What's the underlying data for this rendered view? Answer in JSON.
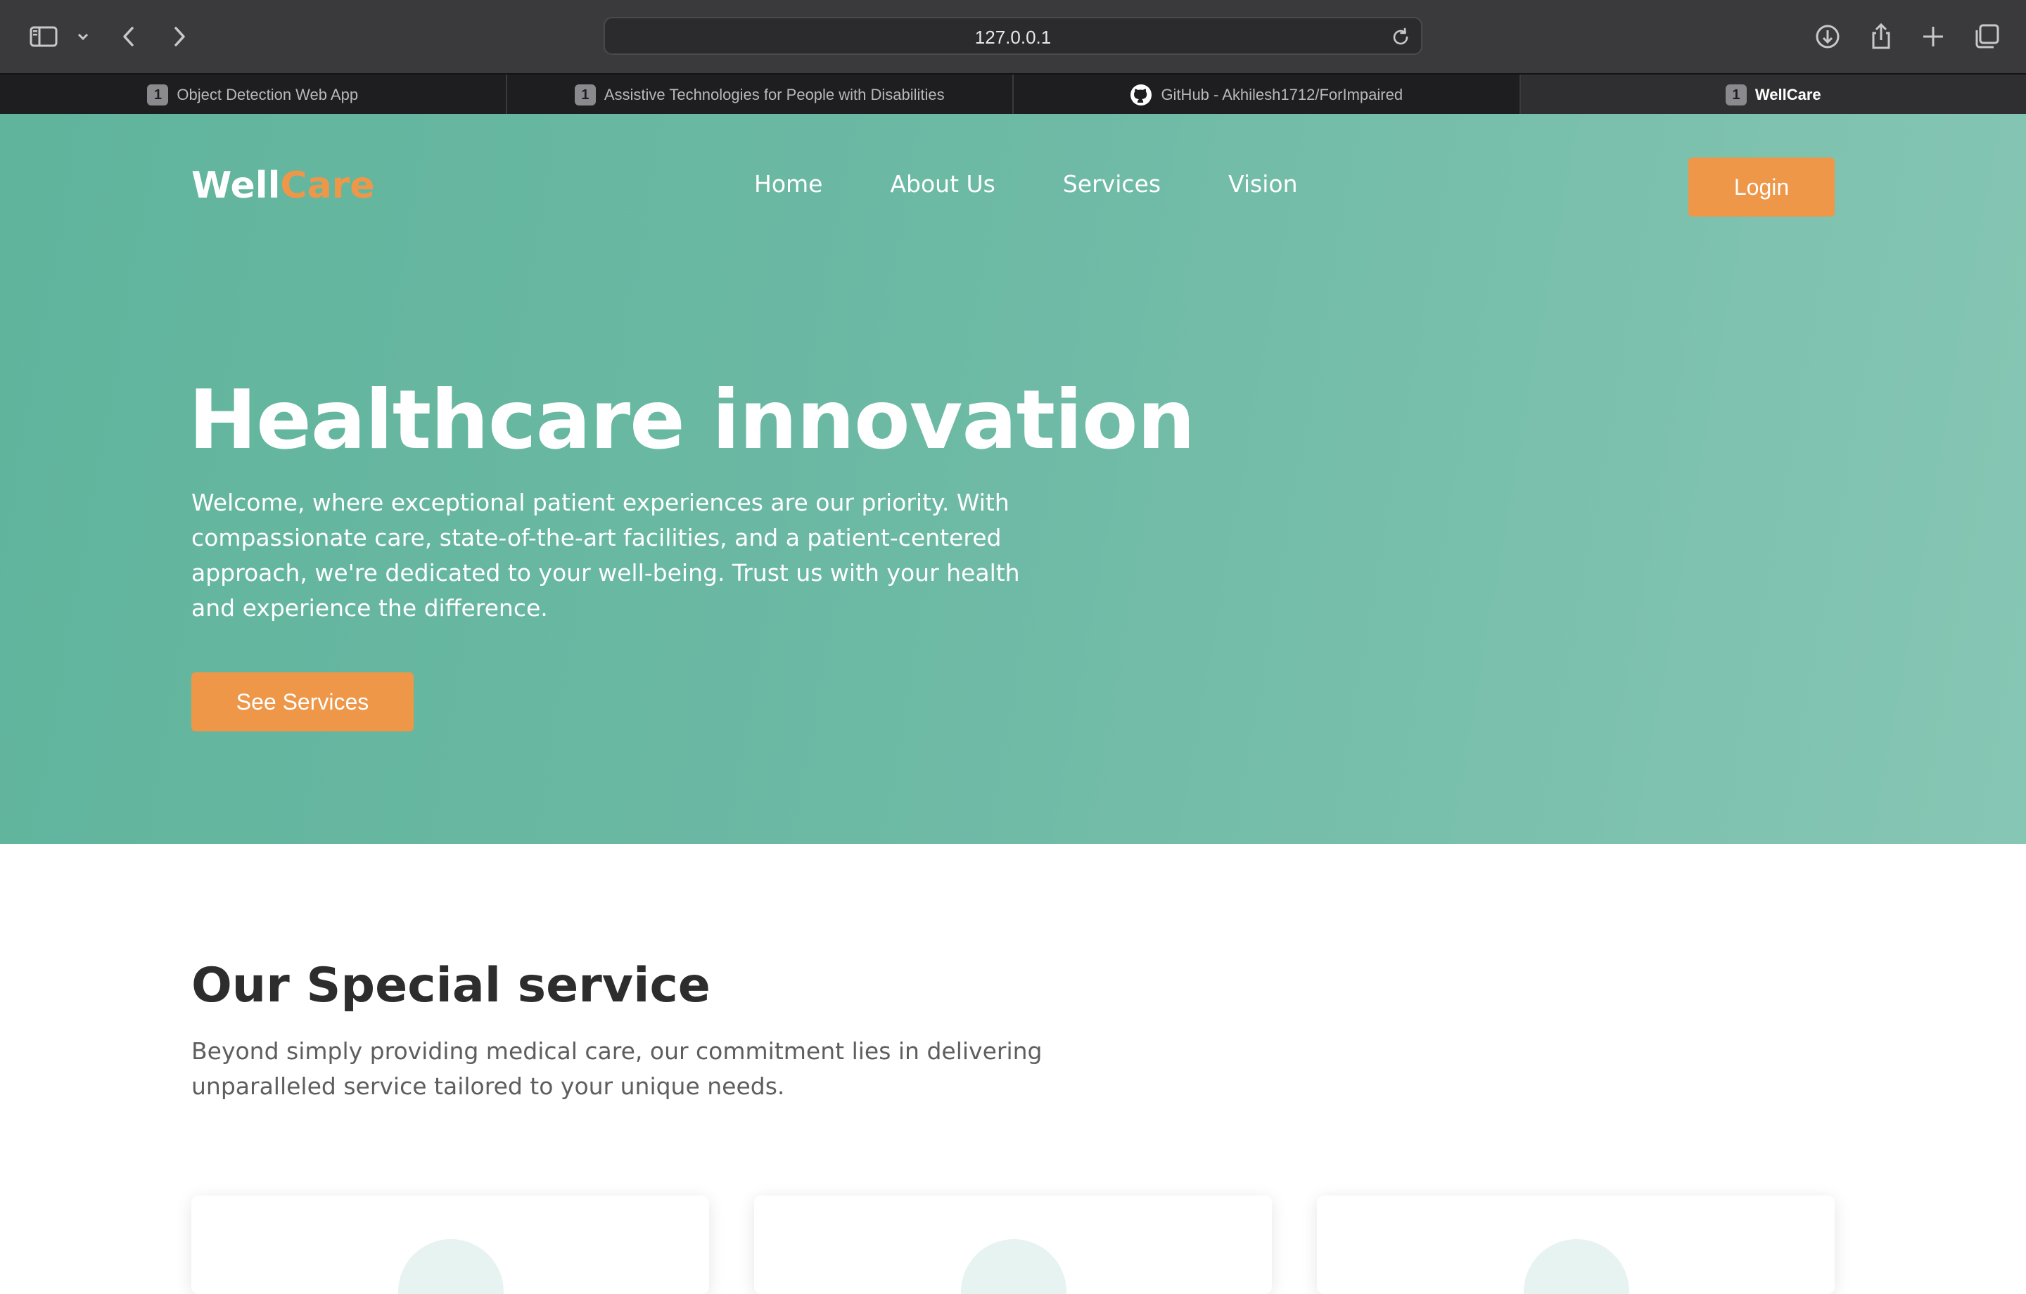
{
  "browser": {
    "url": "127.0.0.1",
    "tabs": [
      {
        "label": "Object Detection Web App",
        "badge": "1",
        "icon": "badge"
      },
      {
        "label": "Assistive Technologies for People with Disabilities",
        "badge": "1",
        "icon": "badge"
      },
      {
        "label": "GitHub - Akhilesh1712/ForImpaired",
        "badge": "",
        "icon": "github-icon"
      },
      {
        "label": "WellCare",
        "badge": "1",
        "icon": "badge",
        "active": true
      }
    ]
  },
  "site": {
    "logo_well": "Well",
    "logo_care": "Care",
    "nav": [
      "Home",
      "About Us",
      "Services",
      "Vision"
    ],
    "login_label": "Login",
    "colors": {
      "primary": "#6cb9a4",
      "accent": "#ee9749"
    }
  },
  "hero": {
    "title": "Healthcare innovation",
    "text": "Welcome, where exceptional patient experiences are our priority. With compassionate care, state-of-the-art facilities, and a patient-centered approach, we're dedicated to your well-being. Trust us with your health and experience the difference.",
    "cta_label": "See Services"
  },
  "services": {
    "title": "Our Special service",
    "text": "Beyond simply providing medical care, our commitment lies in delivering unparalleled service tailored to your unique needs."
  }
}
